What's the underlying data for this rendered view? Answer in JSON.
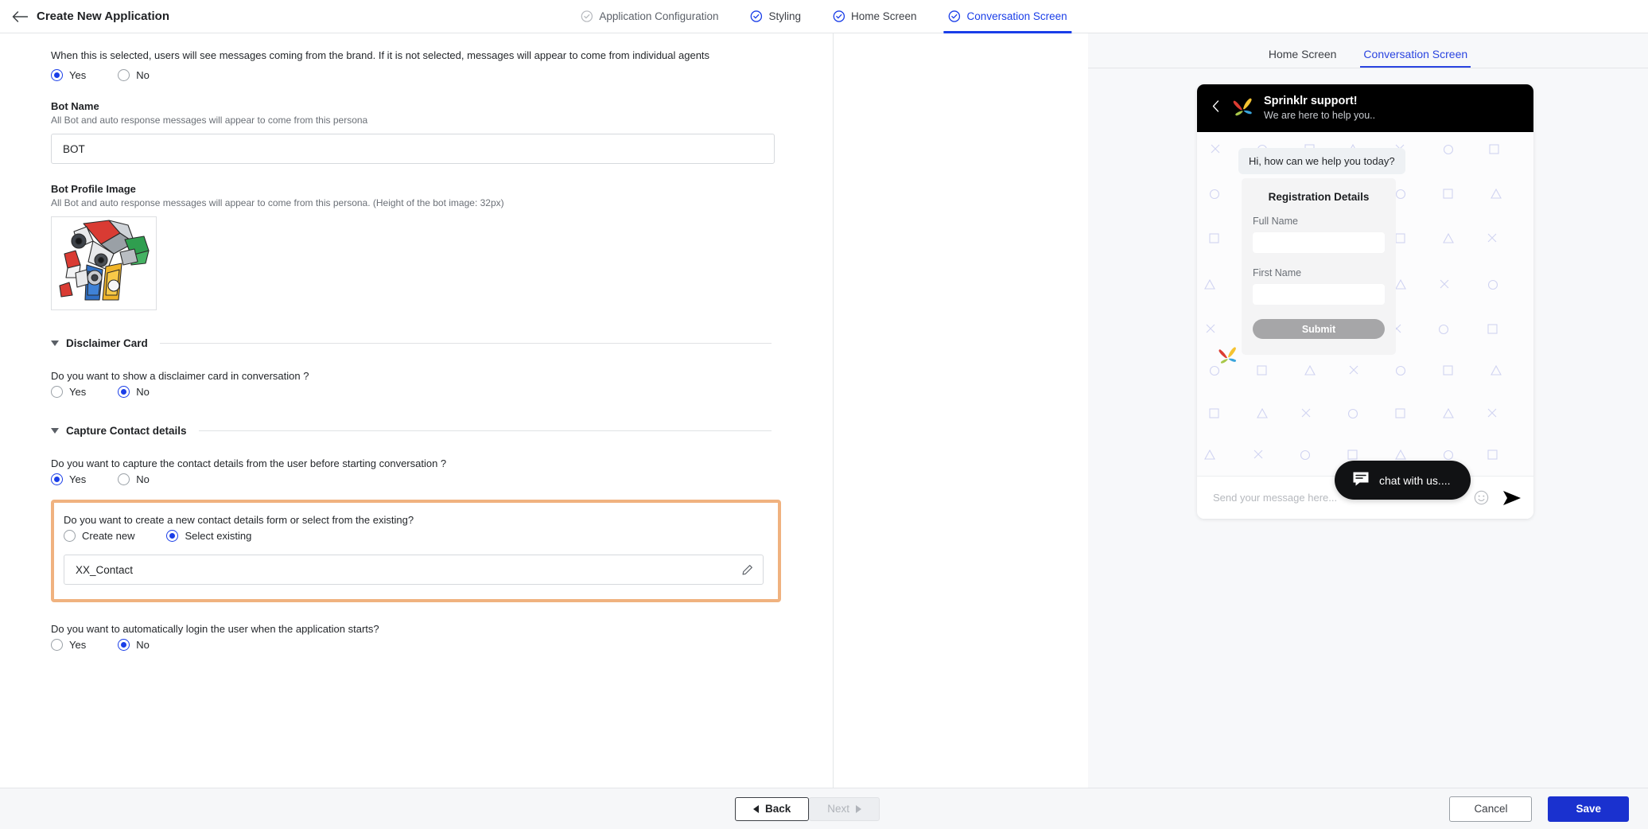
{
  "topbar": {
    "back_icon": "arrow-left-icon",
    "title": "Create New Application",
    "steps": [
      {
        "label": "Application Configuration",
        "state": "complete-grey"
      },
      {
        "label": "Styling",
        "state": "complete"
      },
      {
        "label": "Home Screen",
        "state": "complete"
      },
      {
        "label": "Conversation Screen",
        "state": "active"
      }
    ]
  },
  "form": {
    "brand_helper": "When this is selected, users will see messages coming from the brand. If it is not selected, messages will appear to come from individual agents",
    "brand_options": [
      "Yes",
      "No"
    ],
    "brand_selected": "Yes",
    "bot_name": {
      "label": "Bot Name",
      "sub": "All Bot and auto response messages will appear to come from this persona",
      "value": "BOT"
    },
    "bot_image": {
      "label": "Bot Profile Image",
      "sub": "All Bot and auto response messages will appear to come from this persona. (Height of the bot image: 32px)",
      "alt": "robot-avatar"
    },
    "disclaimer": {
      "section_title": "Disclaimer Card",
      "question": "Do you want to show a disclaimer card in conversation ?",
      "options": [
        "Yes",
        "No"
      ],
      "selected": "No"
    },
    "capture": {
      "section_title": "Capture Contact details",
      "question": "Do you want to capture the contact details from the user before starting conversation ?",
      "options": [
        "Yes",
        "No"
      ],
      "selected": "Yes",
      "form_question": "Do you want to create a new contact details form or select from the existing?",
      "form_options": [
        "Create new",
        "Select existing"
      ],
      "form_selected": "Select existing",
      "existing_form_value": "XX_Contact",
      "edit_icon": "pencil-icon",
      "autologin_question": "Do you want to automatically login the user when the application starts?",
      "autologin_options": [
        "Yes",
        "No"
      ],
      "autologin_selected": "No"
    }
  },
  "preview": {
    "tabs": [
      "Home Screen",
      "Conversation Screen"
    ],
    "active_tab": "Conversation Screen",
    "widget": {
      "back_icon": "chevron-left-icon",
      "logo_icon": "sprinklr-logo-icon",
      "title": "Sprinklr support!",
      "subtitle": "We are here to help you..",
      "greeting": "Hi, how can we help you today?",
      "card": {
        "title": "Registration Details",
        "fields": [
          {
            "label": "Full Name",
            "value": ""
          },
          {
            "label": "First Name",
            "value": ""
          }
        ],
        "submit_label": "Submit"
      },
      "composer_placeholder": "Send your message here...",
      "emoji_icon": "smiley-icon",
      "send_icon": "send-icon"
    },
    "launcher": {
      "icon": "chat-bubble-icon",
      "label": "chat with us...."
    }
  },
  "footer": {
    "back_label": "Back",
    "next_label": "Next",
    "cancel_label": "Cancel",
    "save_label": "Save"
  },
  "colors": {
    "accent_blue": "#1a3ee8",
    "save_blue": "#1a31cf",
    "highlight_orange": "#f0b27f",
    "widget_header": "#000000"
  }
}
